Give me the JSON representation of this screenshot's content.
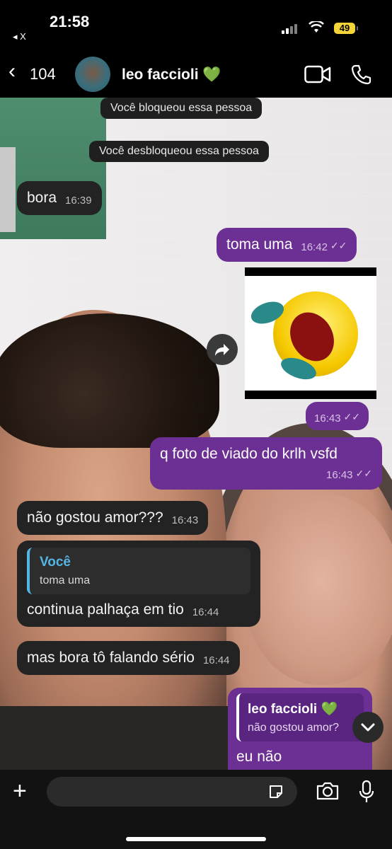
{
  "status": {
    "time": "21:58",
    "back_app": "◂ X",
    "battery": "49"
  },
  "header": {
    "back_count": "104",
    "contact_name": "leo faccioli",
    "contact_emoji": "💚"
  },
  "system_messages": [
    "Você bloqueou essa pessoa",
    "Você desbloqueou essa pessoa"
  ],
  "messages": [
    {
      "text": "bora",
      "time": "16:39"
    },
    {
      "text": "toma uma",
      "time": "16:42",
      "tick": "✓✓"
    },
    {
      "text": "",
      "time": "16:43",
      "tick": "✓✓"
    },
    {
      "text": "q foto de viado do krlh vsfd",
      "time": "16:43",
      "tick": "✓✓"
    },
    {
      "text": "não gostou amor???",
      "time": "16:43"
    },
    {
      "reply_name": "Você",
      "reply_text": "toma uma",
      "text": "continua palhaça em tio",
      "time": "16:44"
    },
    {
      "text": "mas bora tô falando sério",
      "time": "16:44"
    },
    {
      "reply_name": "leo faccioli",
      "reply_emoji": "💚",
      "reply_text": "não gostou amor?",
      "text": "eu não"
    }
  ],
  "icons": {
    "back": "chevron-left-icon",
    "video": "video-camera-icon",
    "phone": "phone-icon",
    "forward": "forward-icon",
    "scroll": "chevron-down-icon",
    "plus": "plus-icon",
    "sticker": "sticker-icon",
    "camera": "camera-icon",
    "mic": "microphone-icon"
  },
  "colors": {
    "outgoing": "#6c2f93",
    "incoming": "#232323",
    "reply_accent": "#54b6e4",
    "battery": "#f5d33a"
  }
}
